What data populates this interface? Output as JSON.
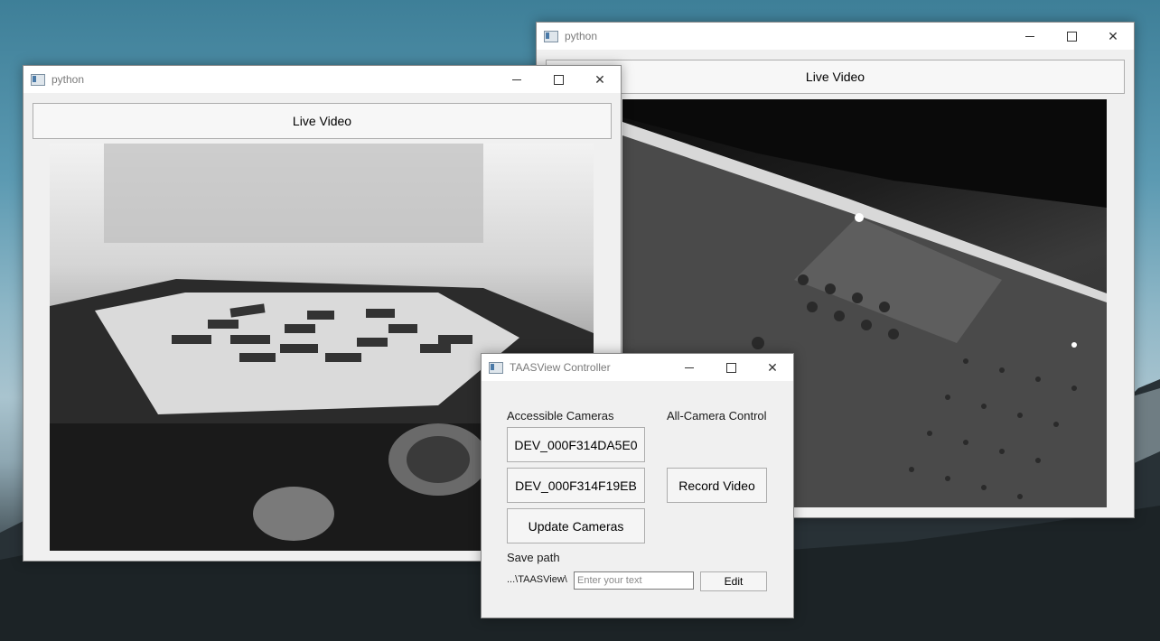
{
  "desktop": {
    "wallpaper": "blue sky over dark mountain range"
  },
  "window_a": {
    "title": "python",
    "live_video_label": "Live Video"
  },
  "window_b": {
    "title": "python",
    "live_video_label": "Live Video"
  },
  "controller": {
    "title": "TAASView Controller",
    "accessible_cameras_label": "Accessible Cameras",
    "all_camera_control_label": "All-Camera Control",
    "cameras": [
      "DEV_000F314DA5E0",
      "DEV_000F314F19EB"
    ],
    "record_video_label": "Record Video",
    "update_cameras_label": "Update Cameras",
    "save_path_label": "Save path",
    "save_path_value": "...\\TAASView\\",
    "path_input_placeholder": "Enter your text",
    "edit_label": "Edit"
  },
  "icons": {
    "app": "window-app-icon",
    "minimize": "minimize-icon",
    "maximize": "maximize-icon",
    "close": "close-icon"
  }
}
